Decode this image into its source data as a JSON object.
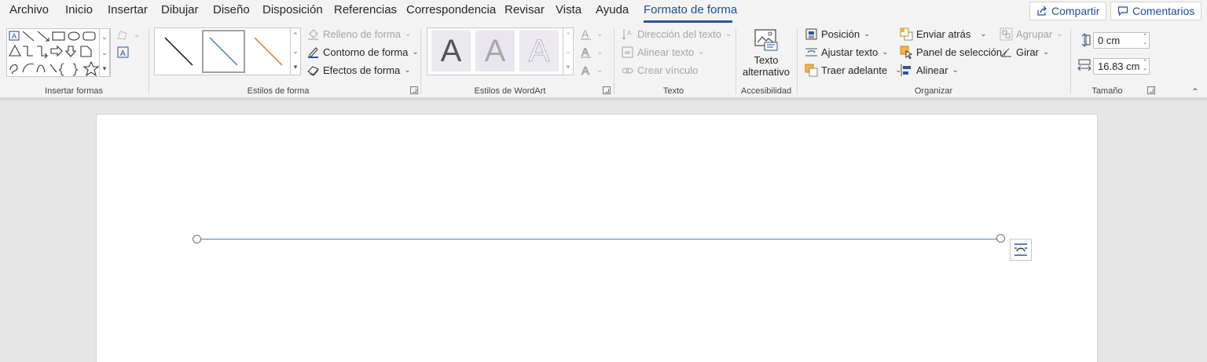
{
  "tabs": [
    {
      "label": "Archivo",
      "active": false
    },
    {
      "label": "Inicio",
      "active": false
    },
    {
      "label": "Insertar",
      "active": false
    },
    {
      "label": "Dibujar",
      "active": false
    },
    {
      "label": "Diseño",
      "active": false
    },
    {
      "label": "Disposición",
      "active": false
    },
    {
      "label": "Referencias",
      "active": false
    },
    {
      "label": "Correspondencia",
      "active": false
    },
    {
      "label": "Revisar",
      "active": false
    },
    {
      "label": "Vista",
      "active": false
    },
    {
      "label": "Ayuda",
      "active": false
    },
    {
      "label": "Formato de forma",
      "active": true
    }
  ],
  "top_actions": {
    "share": "Compartir",
    "comments": "Comentarios"
  },
  "groups": {
    "insert_shapes": "Insertar formas",
    "shape_styles": "Estilos de forma",
    "wordart_styles": "Estilos de WordArt",
    "text": "Texto",
    "accessibility": "Accesibilidad",
    "arrange": "Organizar",
    "size": "Tamaño"
  },
  "shape_styles": {
    "fill": "Relleno de forma",
    "outline": "Contorno de forma",
    "effects": "Efectos de forma"
  },
  "text_group": {
    "direction": "Dirección del texto",
    "align": "Alinear texto",
    "link": "Crear vínculo"
  },
  "accessibility": {
    "alt_text_line1": "Texto",
    "alt_text_line2": "alternativo"
  },
  "arrange": {
    "position": "Posición",
    "wrap": "Ajustar texto",
    "bring_forward": "Traer adelante",
    "send_backward": "Enviar atrás",
    "selection_pane": "Panel de selección",
    "align": "Alinear",
    "group": "Agrupar",
    "rotate": "Girar"
  },
  "size": {
    "height": "0 cm",
    "width": "16.83 cm"
  },
  "wordart_letter": "A",
  "colors": {
    "accent": "#2b579a",
    "line_shape": "#4f7fc7",
    "orange": "#e8782b",
    "ribbon_bg": "#f3f3f3",
    "workspace_bg": "#e6e6e6"
  }
}
